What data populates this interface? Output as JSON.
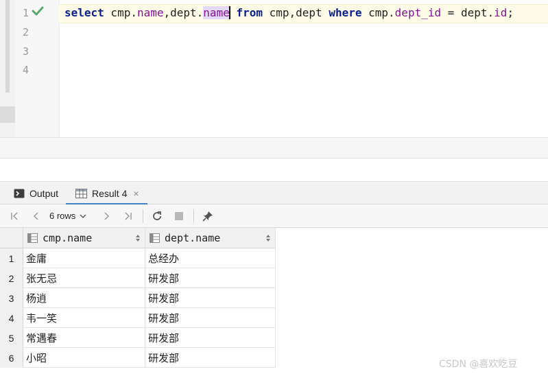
{
  "editor": {
    "line_numbers": [
      "1",
      "2",
      "3",
      "4"
    ],
    "code_tokens": [
      {
        "text": "select",
        "cls": "kw"
      },
      {
        "text": " cmp.",
        "cls": ""
      },
      {
        "text": "name",
        "cls": "fld"
      },
      {
        "text": ",dept.",
        "cls": ""
      },
      {
        "text": "name",
        "cls": "fld hl"
      },
      {
        "text": "",
        "cls": "caret"
      },
      {
        "text": " ",
        "cls": ""
      },
      {
        "text": "from",
        "cls": "kw"
      },
      {
        "text": " cmp,dept ",
        "cls": ""
      },
      {
        "text": "where",
        "cls": "kw"
      },
      {
        "text": " cmp.",
        "cls": ""
      },
      {
        "text": "dept_id",
        "cls": "fld"
      },
      {
        "text": " = dept.",
        "cls": ""
      },
      {
        "text": "id",
        "cls": "fld"
      },
      {
        "text": ";",
        "cls": ""
      }
    ],
    "check_color": "#59a869"
  },
  "tabs": {
    "output_label": "Output",
    "result_label": "Result 4",
    "close_glyph": "×",
    "accent": "#4083c9"
  },
  "toolbar": {
    "rows_label": "6 rows",
    "icons": [
      "first-page-icon",
      "prev-page-icon",
      "next-page-icon",
      "last-page-icon",
      "refresh-icon",
      "stop-icon",
      "pin-icon"
    ]
  },
  "table": {
    "columns": [
      "cmp.name",
      "dept.name"
    ],
    "rows": [
      {
        "num": "1",
        "cells": [
          "金庸",
          "总经办"
        ]
      },
      {
        "num": "2",
        "cells": [
          "张无忌",
          "研发部"
        ]
      },
      {
        "num": "3",
        "cells": [
          "杨逍",
          "研发部"
        ]
      },
      {
        "num": "4",
        "cells": [
          "韦一笑",
          "研发部"
        ]
      },
      {
        "num": "5",
        "cells": [
          "常遇春",
          "研发部"
        ]
      },
      {
        "num": "6",
        "cells": [
          "小昭",
          "研发部"
        ]
      }
    ]
  },
  "watermark": "CSDN @喜欢吃豆"
}
